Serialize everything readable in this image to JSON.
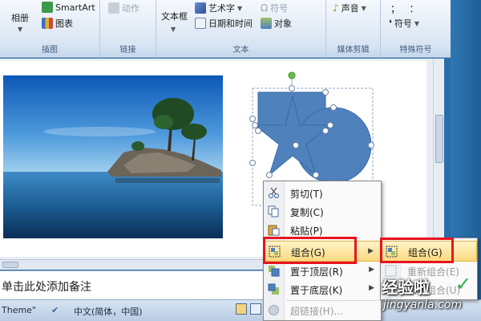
{
  "ribbon": {
    "groups": [
      {
        "label": "插图",
        "buttons": {
          "album": "相册",
          "smartart": "SmartArt",
          "chart": "图表"
        }
      },
      {
        "label": "链接",
        "buttons": {
          "action": "动作"
        }
      },
      {
        "label": "文本",
        "buttons": {
          "textbox": "文本框",
          "wordart": "艺术字",
          "datetime": "日期和时间",
          "symbol": "符号",
          "object": "对象"
        }
      },
      {
        "label": "媒体剪辑",
        "buttons": {
          "sound": "声音"
        }
      },
      {
        "label": "特殊符号",
        "buttons": {
          "symbol": "符号"
        }
      }
    ]
  },
  "context_menu": {
    "items": [
      {
        "label": "剪切(T)",
        "icon": "scissors-icon",
        "enabled": true
      },
      {
        "label": "复制(C)",
        "icon": "copy-icon",
        "enabled": true
      },
      {
        "label": "粘贴(P)",
        "icon": "paste-icon",
        "enabled": true
      },
      {
        "label": "组合(G)",
        "icon": "group-icon",
        "enabled": true,
        "highlighted": true,
        "has_submenu": true
      },
      {
        "label": "置于顶层(R)",
        "icon": "bring-to-front-icon",
        "enabled": true,
        "has_submenu": true
      },
      {
        "label": "置于底层(K)",
        "icon": "send-to-back-icon",
        "enabled": true,
        "has_submenu": true
      },
      {
        "label": "超链接(H)...",
        "icon": "hyperlink-icon",
        "enabled": false
      }
    ]
  },
  "submenu": {
    "items": [
      {
        "label": "组合(G)",
        "icon": "group-icon",
        "enabled": true,
        "highlighted": true
      },
      {
        "label": "重新组合(E)",
        "icon": "regroup-icon",
        "enabled": false
      },
      {
        "label": "取消组合(U)",
        "icon": "ungroup-icon",
        "enabled": false
      }
    ]
  },
  "notes": {
    "placeholder": "单击此处添加备注"
  },
  "status_bar": {
    "theme": "Theme\"",
    "language": "中文(简体，中国)"
  },
  "watermark": {
    "title": "经验啦",
    "check": "✓",
    "url": "jingyanla.com"
  },
  "colors": {
    "shape_fill": "#4f81bd",
    "highlight_border": "#e8141e",
    "menu_highlight": "#fbd97f",
    "check_green": "#2ab34a"
  }
}
